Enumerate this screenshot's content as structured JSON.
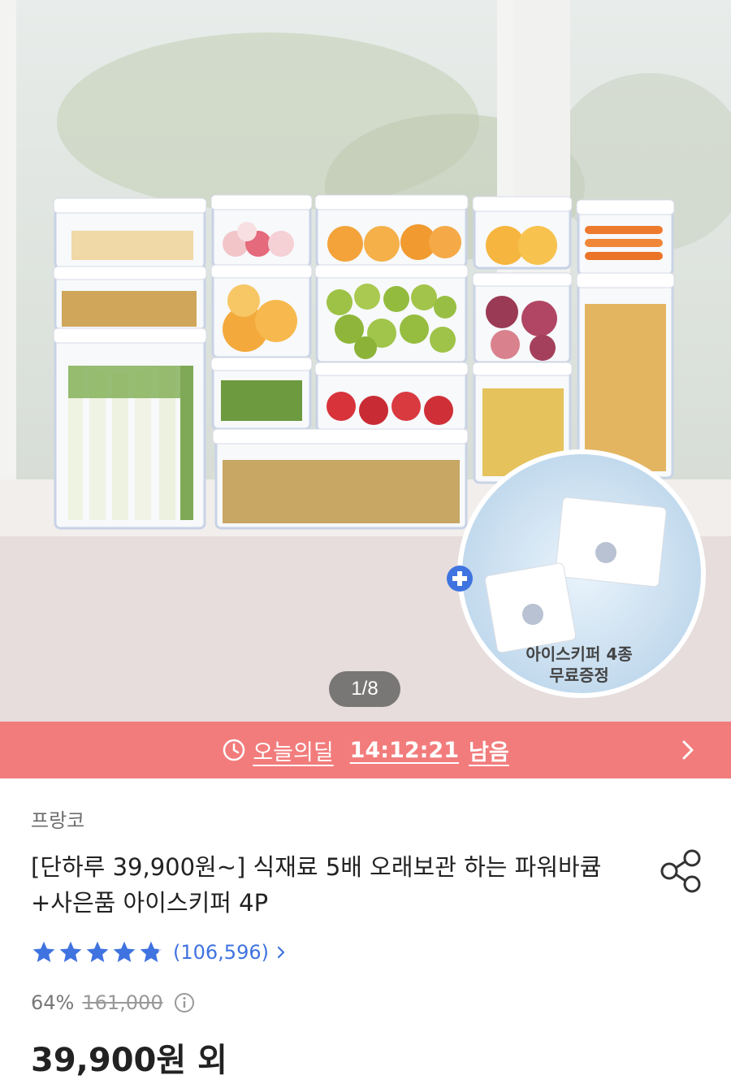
{
  "gallery": {
    "page_indicator": "1/8",
    "gift_caption_line1": "아이스키퍼 4종",
    "gift_caption_line2": "무료증정"
  },
  "deal": {
    "label": "오늘의딜",
    "time_remaining": "14:12:21",
    "suffix": "남음",
    "bar_color": "#f27c7c"
  },
  "product": {
    "brand": "프랑코",
    "title": "[단하루 39,900원~] 식재료 5배 오래보관 하는 파워바큠+사은품 아이스키퍼 4P",
    "rating_stars": 4.8,
    "review_count": "(106,596)",
    "discount_percent": "64%",
    "original_price": "161,000",
    "price": "39,900원 외"
  },
  "icons": {
    "deal": "clock-icon",
    "deal_more": "chevron-right-icon",
    "share": "share-icon",
    "reviews_more": "chevron-right-icon",
    "price_info": "info-icon",
    "gift_plus": "plus-icon"
  },
  "colors": {
    "accent_blue": "#3f73e0",
    "star_blue": "#3f73e0"
  }
}
